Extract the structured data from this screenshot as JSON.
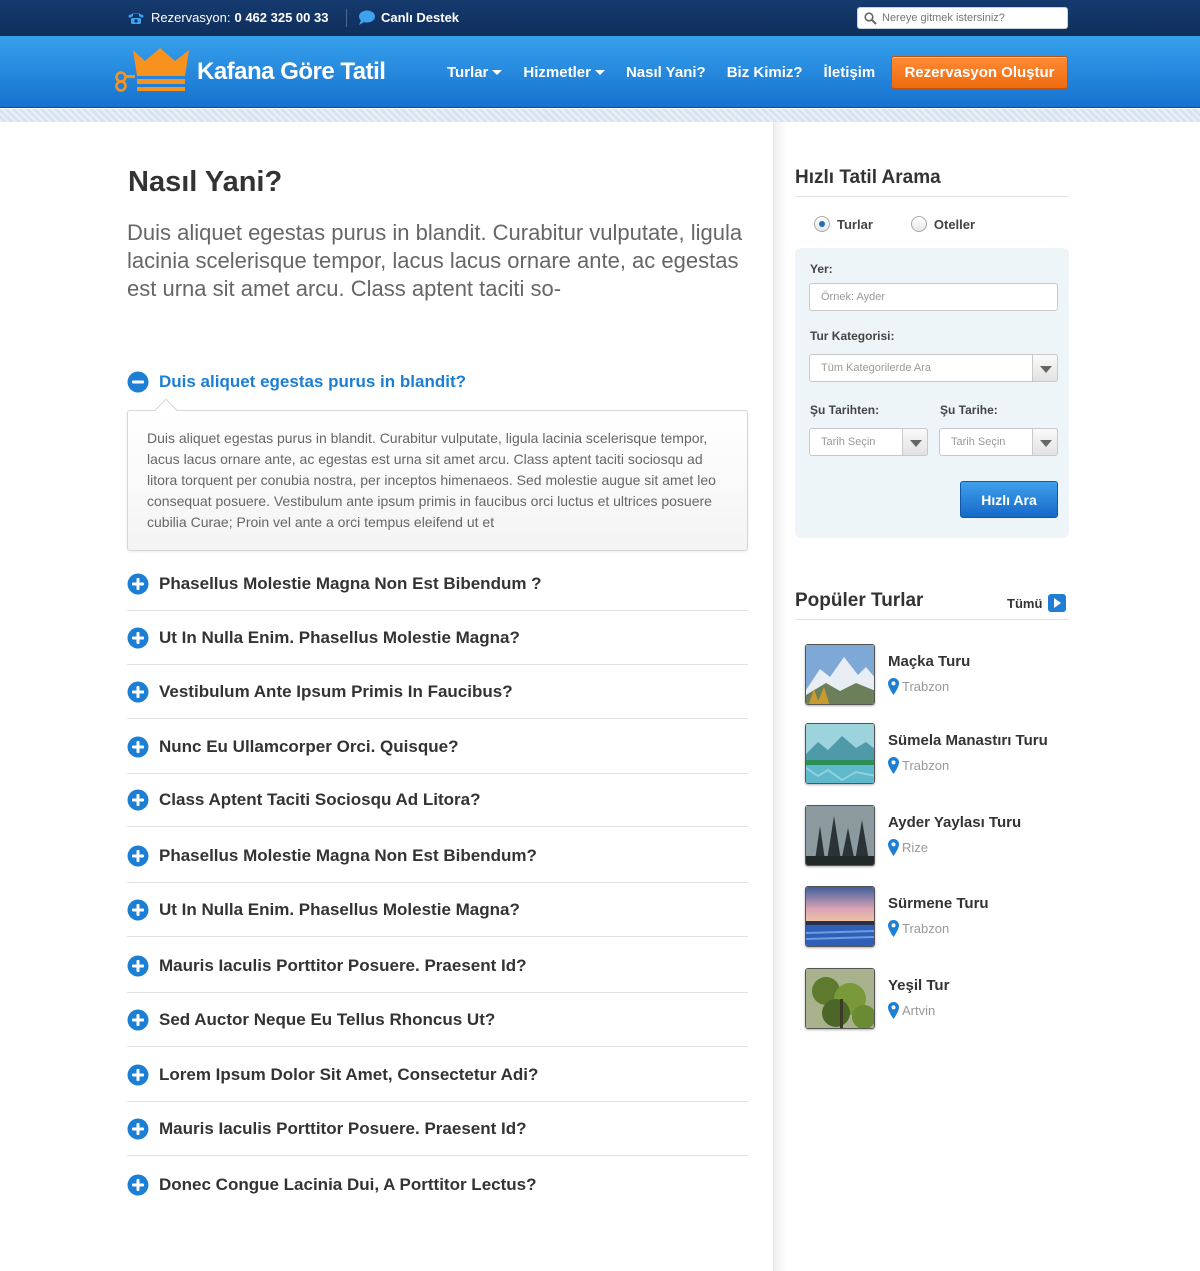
{
  "topbar": {
    "reservation_label": "Rezervasyon:",
    "phone": "0 462 325 00 33",
    "live_support": "Canlı Destek",
    "search_placeholder": "Nereye gitmek istersiniz?"
  },
  "header": {
    "brand": "Kafana Göre Tatil",
    "nav": [
      {
        "label": "Turlar",
        "dropdown": true
      },
      {
        "label": "Hizmetler",
        "dropdown": true
      },
      {
        "label": "Nasıl Yani?",
        "dropdown": false
      },
      {
        "label": "Biz Kimiz?",
        "dropdown": false
      },
      {
        "label": "İletişim",
        "dropdown": false
      }
    ],
    "cta": "Rezervasyon Oluştur"
  },
  "main": {
    "title": "Nasıl Yani?",
    "intro": "Duis aliquet egestas purus in blandit. Curabitur vulputate, ligula lacinia scelerisque tempor, lacus lacus ornare ante, ac egestas est urna sit amet arcu. Class aptent taciti so-",
    "open_question": "Duis aliquet egestas purus in blandit?",
    "open_answer": "Duis aliquet egestas purus in blandit. Curabitur vulputate, ligula lacinia scelerisque tempor, lacus lacus ornare ante, ac egestas est urna sit amet arcu. Class aptent taciti sociosqu ad litora torquent per conubia nostra, per inceptos himenaeos. Sed molestie augue sit amet leo consequat posuere. Vestibulum ante ipsum primis in faucibus orci luctus et ultrices posuere cubilia Curae; Proin vel ante a orci tempus eleifend ut et",
    "questions": [
      "Phasellus Molestie Magna Non Est Bibendum ?",
      "Ut In Nulla Enim. Phasellus Molestie Magna?",
      "Vestibulum Ante Ipsum Primis In Faucibus?",
      "Nunc Eu Ullamcorper Orci. Quisque?",
      "Class Aptent Taciti Sociosqu Ad Litora?",
      "Phasellus Molestie Magna Non Est Bibendum?",
      "Ut In Nulla Enim. Phasellus Molestie Magna?",
      "Mauris Iaculis Porttitor Posuere. Praesent Id?",
      "Sed Auctor Neque Eu Tellus Rhoncus Ut?",
      "Lorem Ipsum Dolor Sit Amet, Consectetur Adi?",
      "Mauris Iaculis Porttitor Posuere. Praesent Id?",
      "Donec Congue Lacinia Dui, A Porttitor Lectus?"
    ]
  },
  "quick_search": {
    "title": "Hızlı Tatil Arama",
    "radio_tours": "Turlar",
    "radio_hotels": "Oteller",
    "selected": "Turlar",
    "place_label": "Yer:",
    "place_placeholder": "Örnek: Ayder",
    "category_label": "Tur Kategorisi:",
    "category_value": "Tüm Kategorilerde Ara",
    "from_label": "Şu Tarihten:",
    "to_label": "Şu Tarihe:",
    "from_value": "Tarih Seçin",
    "to_value": "Tarih Seçin",
    "button": "Hızlı Ara"
  },
  "popular": {
    "title": "Popüler Turlar",
    "all_label": "Tümü",
    "tours": [
      {
        "name": "Maçka Turu",
        "location": "Trabzon"
      },
      {
        "name": "Sümela Manastırı Turu",
        "location": "Trabzon"
      },
      {
        "name": "Ayder Yaylası Turu",
        "location": "Rize"
      },
      {
        "name": "Sürmene Turu",
        "location": "Trabzon"
      },
      {
        "name": "Yeşil Tur",
        "location": "Artvin"
      }
    ]
  },
  "colors": {
    "brand_blue": "#1d7fd4",
    "cta_orange": "#f06a0d",
    "topbar_navy": "#153a6e"
  }
}
